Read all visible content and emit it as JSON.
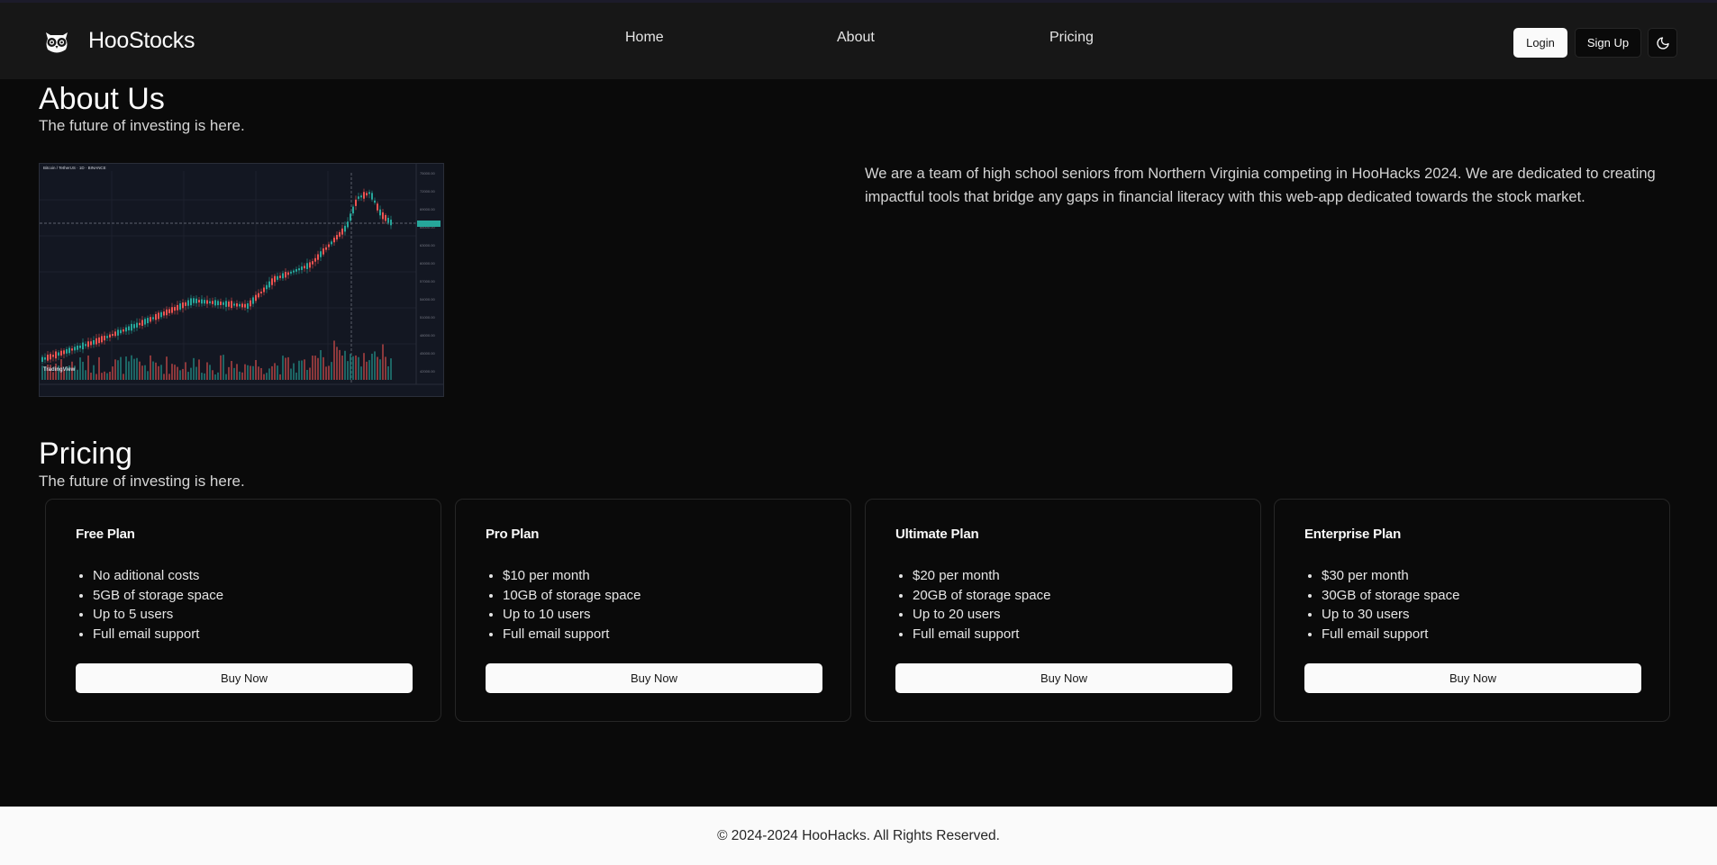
{
  "header": {
    "brand": "HooStocks",
    "nav": [
      "Home",
      "About",
      "Pricing"
    ],
    "login_label": "Login",
    "signup_label": "Sign Up"
  },
  "about": {
    "title": "About Us",
    "subtitle": "The future of investing is here.",
    "description": "We are a team of high school seniors from Northern Virginia competing in HooHacks 2024. We are dedicated to creating impactful tools that bridge any gaps in financial literacy with this web-app dedicated towards the stock market."
  },
  "chart_image": {
    "header_text": "Bitcoin / TetherUS · 1D · BINANCE",
    "watermark": "TradingView"
  },
  "pricing": {
    "title": "Pricing",
    "subtitle": "The future of investing is here.",
    "plans": [
      {
        "name": "Free Plan",
        "features": [
          "No aditional costs",
          "5GB of storage space",
          "Up to 5 users",
          "Full email support"
        ],
        "button": "Buy Now"
      },
      {
        "name": "Pro Plan",
        "features": [
          "$10 per month",
          "10GB of storage space",
          "Up to 10 users",
          "Full email support"
        ],
        "button": "Buy Now"
      },
      {
        "name": "Ultimate Plan",
        "features": [
          "$20 per month",
          "20GB of storage space",
          "Up to 20 users",
          "Full email support"
        ],
        "button": "Buy Now"
      },
      {
        "name": "Enterprise Plan",
        "features": [
          "$30 per month",
          "30GB of storage space",
          "Up to 30 users",
          "Full email support"
        ],
        "button": "Buy Now"
      }
    ]
  },
  "footer": {
    "copyright": "© 2024-2024 HooHacks. All Rights Reserved."
  },
  "colors": {
    "background": "#0a0a0a",
    "header": "#171717",
    "candle_up": "#26a69a",
    "candle_down": "#ef5350"
  }
}
